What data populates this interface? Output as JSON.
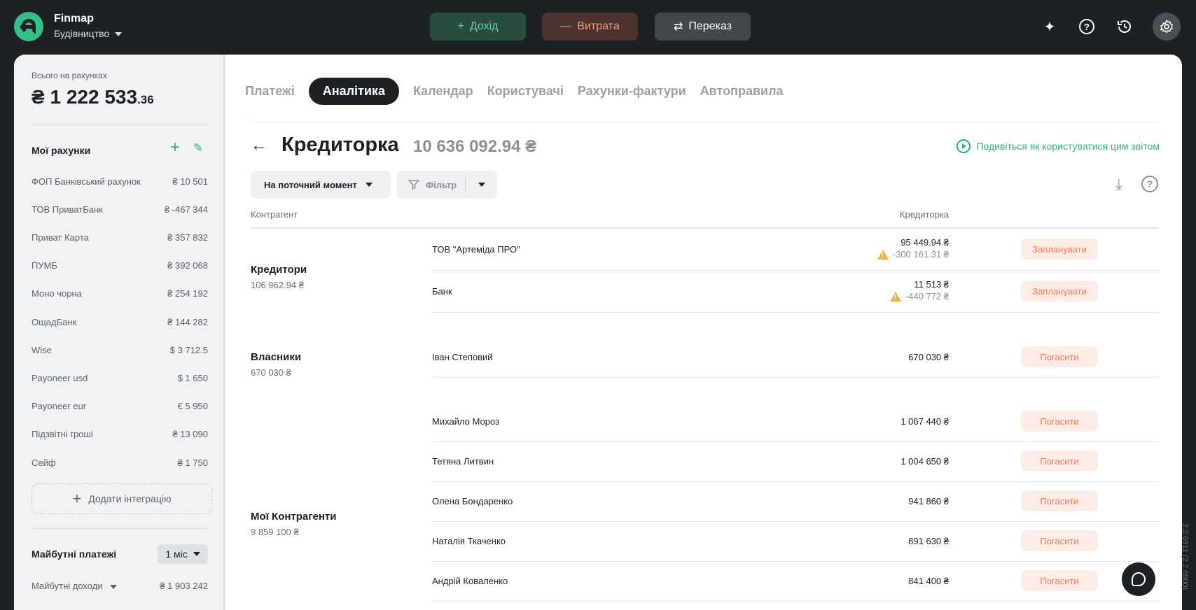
{
  "app": {
    "brand": "Finmap",
    "company": "Будівництво"
  },
  "topbar": {
    "income_label": "Дохід",
    "expense_label": "Витрата",
    "transfer_label": "Переказ"
  },
  "sidebar": {
    "total_caption": "Всього на рахунках",
    "total_currency": "₴",
    "total_main": "1 222 533",
    "total_cents": ".36",
    "accounts_title": "Мої рахунки",
    "accounts": [
      {
        "name": "ФОП Банківський рахунок",
        "value": "₴ 10 501"
      },
      {
        "name": "ТОВ ПриватБанк",
        "value": "₴ -467 344"
      },
      {
        "name": "Приват Карта",
        "value": "₴ 357 832"
      },
      {
        "name": "ПУМБ",
        "value": "₴ 392 068"
      },
      {
        "name": "Моно чорна",
        "value": "₴ 254 192"
      },
      {
        "name": "ОщадБанк",
        "value": "₴ 144 282"
      },
      {
        "name": "Wise",
        "value": "$ 3 712.5"
      },
      {
        "name": "Payoneer usd",
        "value": "$ 1 650"
      },
      {
        "name": "Payoneer eur",
        "value": "€ 5 950"
      },
      {
        "name": "Підзвітні гроші",
        "value": "₴ 13 090"
      },
      {
        "name": "Сейф",
        "value": "₴ 1 750"
      }
    ],
    "add_integration": "Додати інтеграцію",
    "future_title": "Майбутні платежі",
    "future_period": "1 міс",
    "future_income_label": "Майбутні доходи",
    "future_income_value": "₴ 1 903 242"
  },
  "tabs": [
    "Платежі",
    "Аналітика",
    "Календар",
    "Користувачі",
    "Рахунки-фактури",
    "Автоправила"
  ],
  "report": {
    "title": "Кредиторка",
    "total": "10 636 092.94 ₴",
    "howto": "Подивіться як користуватися цим звітом",
    "moment_filter": "На поточний момент",
    "filter_label": "Фільтр",
    "col_counterparty": "Контрагент",
    "col_credit": "Кредиторка"
  },
  "groups": [
    {
      "name": "Кредитори",
      "sum": "106 962.94 ₴"
    },
    {
      "name": "Власники",
      "sum": "670 030 ₴"
    },
    {
      "name": "Мої Контрагенти",
      "sum": "9 859 100 ₴"
    }
  ],
  "rows": [
    {
      "name": "ТОВ \"Артеміда ПРО\"",
      "amount": "95 449.94 ₴",
      "sub": "-300 161.31 ₴",
      "action": "Запланувати"
    },
    {
      "name": "Банк",
      "amount": "11 513 ₴",
      "sub": "-440 772 ₴",
      "action": "Запланувати"
    },
    {
      "name": "Іван Степовий",
      "amount": "670 030 ₴",
      "action": "Погасити"
    },
    {
      "name": "Михайло Мороз",
      "amount": "1 067 440 ₴",
      "action": "Погасити"
    },
    {
      "name": "Тетяна Литвин",
      "amount": "1 004 650 ₴",
      "action": "Погасити"
    },
    {
      "name": "Олена Бондаренко",
      "amount": "941 860 ₴",
      "action": "Погасити"
    },
    {
      "name": "Наталія Ткаченко",
      "amount": "891 630 ₴",
      "action": "Погасити"
    },
    {
      "name": "Андрій Коваленко",
      "amount": "841 400 ₴",
      "action": "Погасити"
    }
  ],
  "version": "2.2.6911 (2.2.6900)",
  "colors": {
    "accent": "#2eb37d",
    "expense": "#f0795a",
    "dark": "#1d2126"
  }
}
